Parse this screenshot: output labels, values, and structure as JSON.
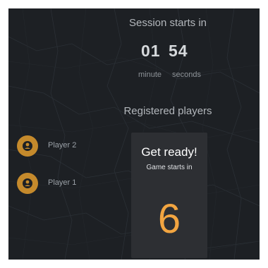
{
  "session": {
    "title": "Session starts in",
    "minutes": "01",
    "seconds": "54",
    "minute_label": "minute",
    "seconds_label": "seconds"
  },
  "players": {
    "title": "Registered players",
    "items": [
      {
        "name": "Player 2",
        "icon": "person-icon"
      },
      {
        "name": "Player 1",
        "icon": "person-icon"
      }
    ]
  },
  "ready_card": {
    "title": "Get ready!",
    "subtitle": "Game starts in",
    "count": "6"
  },
  "colors": {
    "background": "#1d2024",
    "card": "#2d2f33",
    "accent": "#f2a541",
    "avatar": "#c58a2c"
  }
}
